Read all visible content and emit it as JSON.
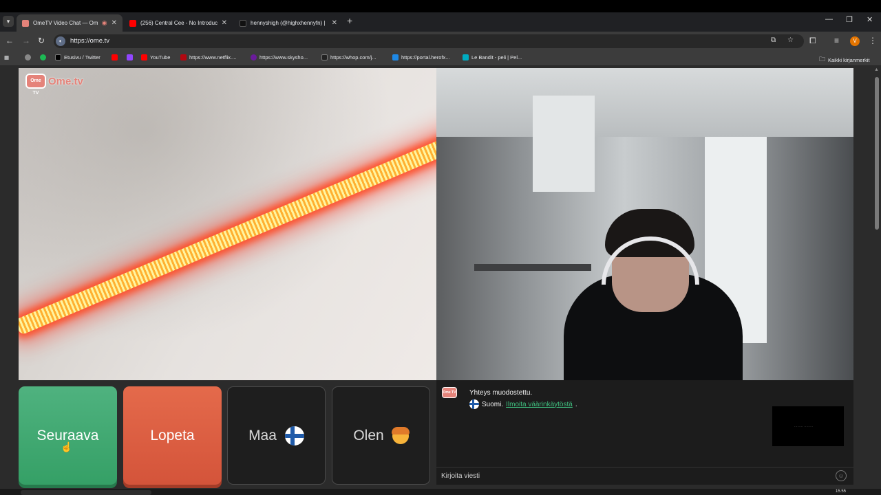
{
  "browser": {
    "tabs": [
      {
        "title": "OmeTV Video Chat — Ome",
        "favicon_color": "#e5837a",
        "active": true
      },
      {
        "title": "(256) Central Cee - No Introduc",
        "favicon_color": "#ff0000",
        "active": false
      },
      {
        "title": "hennyshigh (@highxhennyfn) |",
        "favicon_color": "#111111",
        "active": false
      }
    ],
    "url": "https://ome.tv",
    "profile_initial": "V",
    "bookmarks": [
      {
        "label": "",
        "icon_color": "#888888"
      },
      {
        "label": "",
        "icon_color": "#1db954"
      },
      {
        "label": "Etusivu / Twitter",
        "icon_color": "#000000"
      },
      {
        "label": "",
        "icon_color": "#ff0000"
      },
      {
        "label": "",
        "icon_color": "#9146ff"
      },
      {
        "label": "YouTube",
        "icon_color": "#ff0000"
      },
      {
        "label": "https://www.netflix....",
        "icon_color": "#b20710"
      },
      {
        "label": "https://www.skysho...",
        "icon_color": "#6a1b9a"
      },
      {
        "label": "https://whop.com/j...",
        "icon_color": "#222222"
      },
      {
        "label": "https://portal.herofx...",
        "icon_color": "#1e88e5"
      },
      {
        "label": "Le Bandit - peli | Pel...",
        "icon_color": "#00acc1"
      }
    ],
    "all_bookmarks_label": "Kaikki kirjanmerkit"
  },
  "site": {
    "logo_badge": "Ome TV",
    "logo_text": "Ome.tv",
    "buttons": {
      "next": "Seuraava",
      "stop": "Lopeta",
      "country": "Maa",
      "gender": "Olen"
    },
    "chat": {
      "avatar_text": "Ome TV",
      "status_message": "Yhteys muodostettu.",
      "country_name": "Suomi.",
      "report_link": "Ilmoita väärinkäytöstä",
      "report_suffix": ".",
      "input_placeholder": "Kirjoita viesti",
      "preview_text": "........ ........"
    }
  },
  "taskbar": {
    "time": "15.55"
  },
  "colors": {
    "next_button": "#3aa76c",
    "stop_button": "#d95b3f",
    "link": "#3fbf7f"
  }
}
